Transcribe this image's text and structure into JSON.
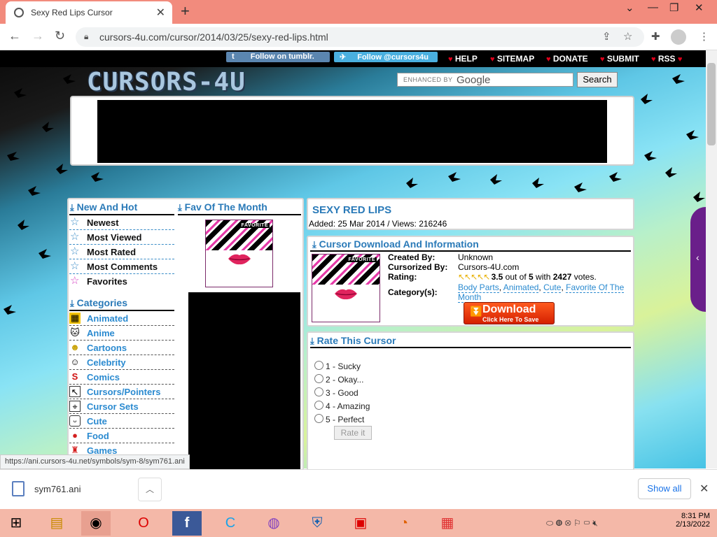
{
  "browser": {
    "tab_title": "Sexy Red Lips Cursor",
    "url": "cursors-4u.com/cursor/2014/03/25/sexy-red-lips.html",
    "status_url": "https://ani.cursors-4u.net/symbols/sym-8/sym761.ani"
  },
  "topnav": {
    "tumblr": "Follow on tumblr.",
    "twitter": "Follow @cursors4u",
    "links": [
      "HELP",
      "SITEMAP",
      "DONATE",
      "SUBMIT",
      "RSS"
    ]
  },
  "site": {
    "logo": "CURSORS-4U",
    "search_label": "ENHANCED BY",
    "search_google": "Google",
    "search_button": "Search"
  },
  "left": {
    "new_hot_title": "New And Hot",
    "fav_month_title": "Fav Of The Month",
    "menu": [
      "Newest",
      "Most Viewed",
      "Most Rated",
      "Most Comments",
      "Favorites"
    ],
    "categories_title": "Categories",
    "categories": [
      {
        "label": "Animated",
        "icon": "animated-icon"
      },
      {
        "label": "Anime",
        "icon": "anime-icon"
      },
      {
        "label": "Cartoons",
        "icon": "cartoons-icon"
      },
      {
        "label": "Celebrity",
        "icon": "celebrity-icon"
      },
      {
        "label": "Comics",
        "icon": "comics-icon"
      },
      {
        "label": "Cursors/Pointers",
        "icon": "pointer-icon"
      },
      {
        "label": "Cursor Sets",
        "icon": "cursor-sets-icon"
      },
      {
        "label": "Cute",
        "icon": "cute-icon"
      },
      {
        "label": "Food",
        "icon": "food-icon"
      },
      {
        "label": "Games",
        "icon": "games-icon"
      }
    ],
    "thumb_tag": "FAVORITE"
  },
  "cursor": {
    "title": "SEXY RED LIPS",
    "meta": "Added: 25 Mar 2014 / Views: 216246",
    "info_title": "Cursor Download And Information",
    "created_by_label": "Created By:",
    "created_by": "Unknown",
    "cursorized_by_label": "Cursorized By:",
    "cursorized_by": "Cursors-4U.com",
    "rating_label": "Rating:",
    "rating_value": "3.5",
    "rating_mid": "out of",
    "rating_max": "5",
    "rating_with": "with",
    "rating_votes": "2427",
    "rating_votes_suffix": "votes.",
    "category_label": "Category(s):",
    "categories": [
      "Body Parts",
      "Animated",
      "Cute",
      "Favorite Of The Month"
    ],
    "download_big": "Download",
    "download_small": "Click Here To Save"
  },
  "rate": {
    "title": "Rate This Cursor",
    "options": [
      "1 - Sucky",
      "2 - Okay...",
      "3 - Good",
      "4 - Amazing",
      "5 - Perfect"
    ],
    "button": "Rate it"
  },
  "downloads": {
    "file": "sym761.ani",
    "show_all": "Show all"
  },
  "taskbar": {
    "time": "8:31 PM",
    "date": "2/13/2022"
  },
  "colors": {
    "accent": "#2a7ab8",
    "tabstrip": "#f28b7d",
    "download": "#e0300a"
  }
}
